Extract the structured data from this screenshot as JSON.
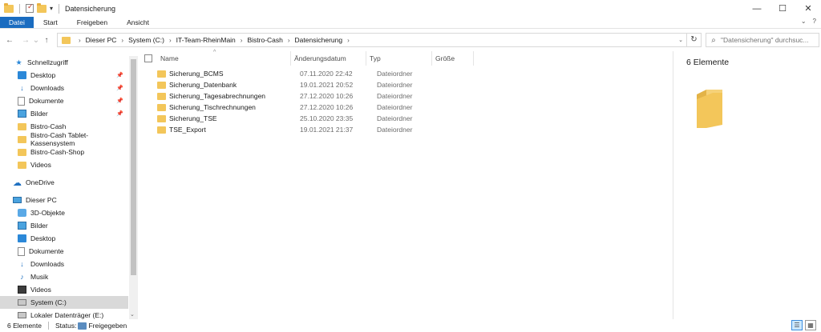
{
  "window": {
    "title": "Datensicherung",
    "qa_dropdown": "▾",
    "btn_minimize": "—",
    "btn_maximize": "☐",
    "btn_close": "✕"
  },
  "ribbon": {
    "tabs": [
      "Datei",
      "Start",
      "Freigeben",
      "Ansicht"
    ],
    "collapse": "⌄",
    "help": "?"
  },
  "nav": {
    "back": "←",
    "forward": "→",
    "recent": "⌄",
    "up": "↑",
    "breadcrumb": [
      "Dieser PC",
      "System (C:)",
      "IT-Team-RheinMain",
      "Bistro-Cash",
      "Datensicherung"
    ],
    "chevron": "›",
    "dropdown": "⌄",
    "refresh": "↻",
    "search_placeholder": "\"Datensicherung\" durchsuc...",
    "search_icon": "⌕"
  },
  "sidebar": {
    "quick_access": {
      "label": "Schnellzugriff",
      "icon": "star-icon",
      "items": [
        {
          "label": "Desktop",
          "icon": "desktop-icon",
          "pinned": true
        },
        {
          "label": "Downloads",
          "icon": "download-icon",
          "pinned": true
        },
        {
          "label": "Dokumente",
          "icon": "documents-icon",
          "pinned": true
        },
        {
          "label": "Bilder",
          "icon": "pictures-icon",
          "pinned": true
        },
        {
          "label": "Bistro-Cash",
          "icon": "folder-icon",
          "pinned": false
        },
        {
          "label": "Bistro-Cash Tablet-Kassensystem",
          "icon": "folder-icon",
          "pinned": false
        },
        {
          "label": "Bistro-Cash-Shop",
          "icon": "folder-icon",
          "pinned": false
        },
        {
          "label": "Videos",
          "icon": "folder-icon",
          "pinned": false
        }
      ]
    },
    "onedrive": {
      "label": "OneDrive",
      "icon": "cloud-icon"
    },
    "this_pc": {
      "label": "Dieser PC",
      "icon": "computer-icon",
      "items": [
        {
          "label": "3D-Objekte",
          "icon": "3d-objects-icon"
        },
        {
          "label": "Bilder",
          "icon": "pictures-icon"
        },
        {
          "label": "Desktop",
          "icon": "desktop-icon"
        },
        {
          "label": "Dokumente",
          "icon": "documents-icon"
        },
        {
          "label": "Downloads",
          "icon": "download-icon"
        },
        {
          "label": "Musik",
          "icon": "music-icon"
        },
        {
          "label": "Videos",
          "icon": "videos-icon"
        },
        {
          "label": "System (C:)",
          "icon": "drive-icon",
          "selected": true
        },
        {
          "label": "Lokaler Datenträger (E:)",
          "icon": "drive-icon"
        }
      ]
    },
    "pin_glyph": "📌",
    "scroll_down": "⌄"
  },
  "columns": {
    "name": "Name",
    "date": "Änderungsdatum",
    "type": "Typ",
    "size": "Größe",
    "sort_arrow": "^"
  },
  "files": [
    {
      "name": "Sicherung_BCMS",
      "date": "07.11.2020 22:42",
      "type": "Dateiordner"
    },
    {
      "name": "Sicherung_Datenbank",
      "date": "19.01.2021 20:52",
      "type": "Dateiordner"
    },
    {
      "name": "Sicherung_Tagesabrechnungen",
      "date": "27.12.2020 10:26",
      "type": "Dateiordner"
    },
    {
      "name": "Sicherung_Tischrechnungen",
      "date": "27.12.2020 10:26",
      "type": "Dateiordner"
    },
    {
      "name": "Sicherung_TSE",
      "date": "25.10.2020 23:35",
      "type": "Dateiordner"
    },
    {
      "name": "TSE_Export",
      "date": "19.01.2021 21:37",
      "type": "Dateiordner"
    }
  ],
  "preview": {
    "count": "6 Elemente"
  },
  "status": {
    "count": "6 Elemente",
    "status_label": "Status:",
    "shared": "Freigegeben",
    "view_details": "☰",
    "view_tiles": "▦"
  },
  "colors": {
    "accent": "#1a6cc0",
    "folder": "#f3c65a",
    "selection": "#cce8ff"
  }
}
